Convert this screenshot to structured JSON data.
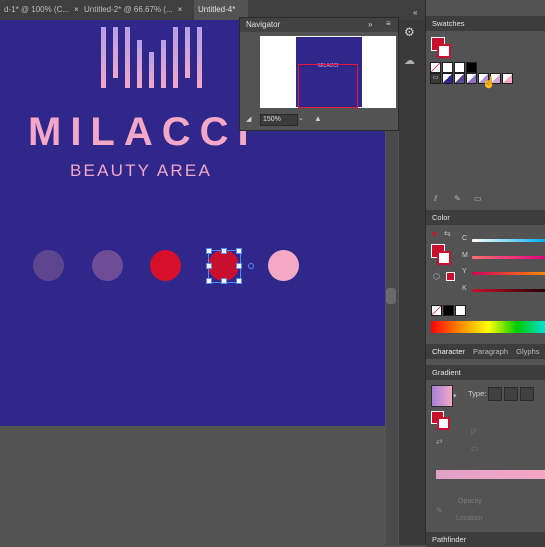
{
  "tabs": [
    {
      "label": "d-1* @ 100% (C...",
      "close": "×"
    },
    {
      "label": "Untitled-2* @ 66.67% (...",
      "close": "×"
    },
    {
      "label": "Untitled-4*",
      "close": ""
    }
  ],
  "artwork": {
    "brand": "MILACCI",
    "tagline": "BEAUTY AREA",
    "dot_colors": [
      "#5e468f",
      "#6e4d96",
      "#d6102a",
      "#c8102e",
      "#f3a8c4"
    ]
  },
  "navigator": {
    "title": "Navigator",
    "logo": "MILACCI",
    "zoom": "150%"
  },
  "panels": {
    "swatches_title": "Swatches",
    "color_title": "Color",
    "color_channels": [
      "C",
      "M",
      "Y",
      "K"
    ],
    "tabs2": [
      "Character",
      "Paragraph",
      "Glyphs"
    ],
    "gradient_title": "Gradient",
    "gradient_type_label": "Type:",
    "gradient_field_1": "Opacity",
    "gradient_field_2": "Location",
    "pathfinder_title": "Pathfinder"
  },
  "colors": {
    "artboard": "#30278b",
    "brand_pink": "#f2a8c6",
    "swatch_red": "#c8102e"
  }
}
